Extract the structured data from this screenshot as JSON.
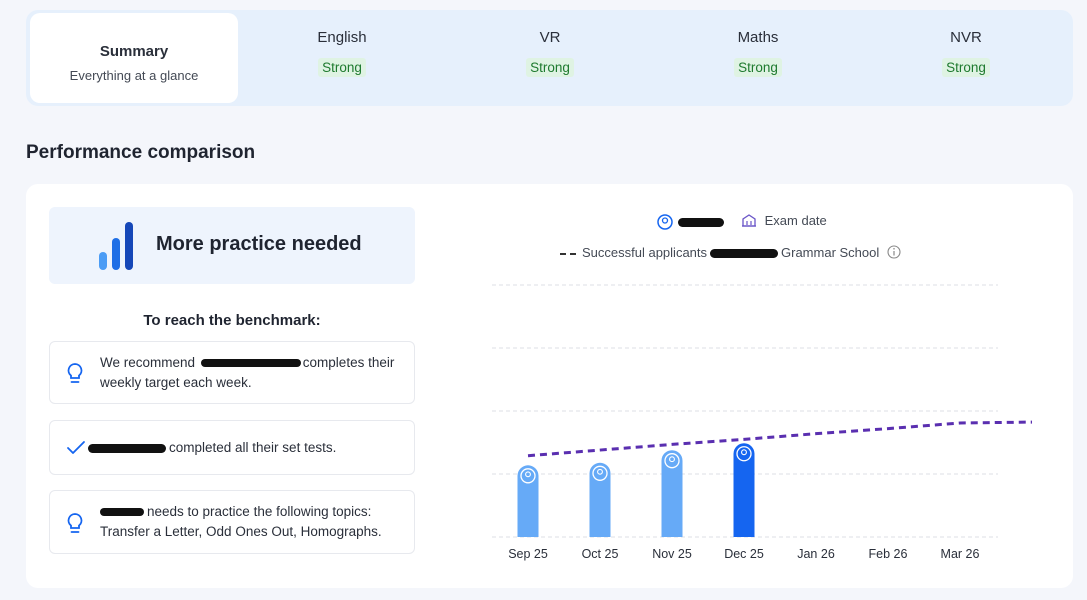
{
  "tabs": [
    {
      "title": "Summary",
      "sub": "Everything at a glance"
    },
    {
      "title": "English",
      "badge": "Strong"
    },
    {
      "title": "VR",
      "badge": "Strong"
    },
    {
      "title": "Maths",
      "badge": "Strong"
    },
    {
      "title": "NVR",
      "badge": "Strong"
    }
  ],
  "section_title": "Performance comparison",
  "status": {
    "label": "More practice needed"
  },
  "benchmark": {
    "title": "To reach the benchmark:",
    "items": [
      {
        "pre": "We recommend ",
        "post": "completes their weekly target each week.",
        "icon": "lightbulb-icon"
      },
      {
        "pre": "",
        "post": "completed all their set tests.",
        "icon": "check-icon"
      },
      {
        "pre": "",
        "post": "needs to practice the following topics: Transfer a Letter, Odd Ones Out, Homographs.",
        "icon": "lightbulb-icon"
      }
    ]
  },
  "legend": {
    "exam_date": "Exam date",
    "benchmark_pre": "Successful applicants",
    "benchmark_post": "Grammar School"
  },
  "colors": {
    "accent": "#1565f0",
    "bar_light": "#66aaf7",
    "benchmark": "#5a2fb0",
    "badge_green": "#1e7a2e"
  },
  "chart_data": {
    "type": "bar",
    "categories": [
      "Sep 25",
      "Oct 25",
      "Nov 25",
      "Dec 25",
      "Jan 26",
      "Feb 26",
      "Mar 26"
    ],
    "values": [
      1.13,
      1.17,
      1.37,
      1.48,
      null,
      null,
      null
    ],
    "highlight_index": 3,
    "benchmark_line": [
      1.29,
      1.38,
      1.47,
      1.55,
      1.64,
      1.72,
      1.81
    ],
    "benchmark_extend_to": 7.45,
    "benchmark_end_value": 1.83,
    "ylim": [
      0,
      4
    ],
    "grid": true
  }
}
